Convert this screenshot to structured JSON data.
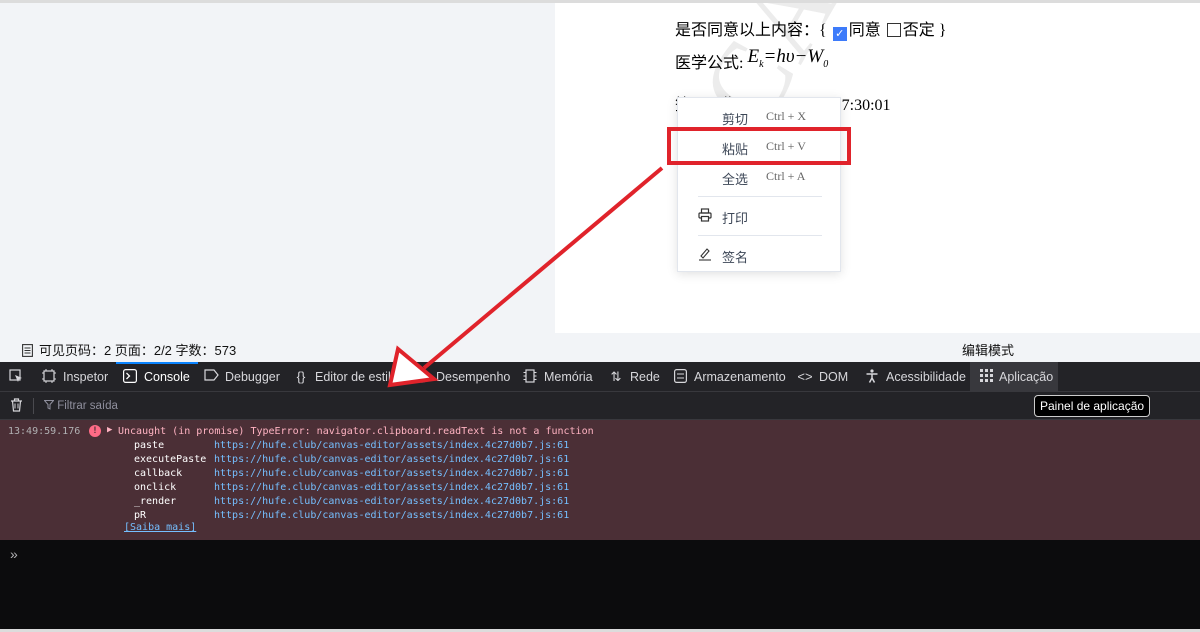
{
  "document": {
    "agree_prefix": "是否同意以上内容：{",
    "agree_yes": "同意",
    "agree_no": "否定",
    "agree_suffix": "}",
    "formula_label": "医学公式:",
    "formula_E": "E",
    "formula_k": "k",
    "formula_rest": "=hυ−W",
    "formula_0": "0",
    "date_line": "签署日期：2022-08-10 17:30:01",
    "watermark": "CANVAS-EDITOR"
  },
  "context_menu": {
    "items": [
      {
        "label": "剪切",
        "shortcut": "Ctrl + X"
      },
      {
        "label": "粘贴",
        "shortcut": "Ctrl + V"
      },
      {
        "label": "全选",
        "shortcut": "Ctrl + A"
      },
      {
        "label": "打印",
        "shortcut": ""
      },
      {
        "label": "签名",
        "shortcut": ""
      }
    ]
  },
  "footer": {
    "page_info": "可见页码：2 页面：2/2 字数：573",
    "mode": "编辑模式"
  },
  "devtools": {
    "tabs": [
      {
        "label": "Inspetor"
      },
      {
        "label": "Console"
      },
      {
        "label": "Debugger"
      },
      {
        "label": "Editor de estilos"
      },
      {
        "label": "Desempenho"
      },
      {
        "label": "Memória"
      },
      {
        "label": "Rede"
      },
      {
        "label": "Armazenamento"
      },
      {
        "label": "DOM"
      },
      {
        "label": "Acessibilidade"
      },
      {
        "label": "Aplicação"
      }
    ],
    "filter_placeholder": "Filtrar saída",
    "tooltip": "Painel de aplicação",
    "error": {
      "timestamp": "13:49:59.176",
      "message": "Uncaught (in promise) TypeError: navigator.clipboard.readText is not a function",
      "stack": [
        {
          "fn": "paste",
          "loc": "https://hufe.club/canvas-editor/assets/index.4c27d0b7.js:61"
        },
        {
          "fn": "executePaste",
          "loc": "https://hufe.club/canvas-editor/assets/index.4c27d0b7.js:61"
        },
        {
          "fn": "callback",
          "loc": "https://hufe.club/canvas-editor/assets/index.4c27d0b7.js:61"
        },
        {
          "fn": "onclick",
          "loc": "https://hufe.club/canvas-editor/assets/index.4c27d0b7.js:61"
        },
        {
          "fn": "_render",
          "loc": "https://hufe.club/canvas-editor/assets/index.4c27d0b7.js:61"
        },
        {
          "fn": "pR",
          "loc": "https://hufe.club/canvas-editor/assets/index.4c27d0b7.js:61"
        }
      ],
      "learn_more": "[Saiba mais]"
    },
    "prompt": "»"
  },
  "colors": {
    "highlight": "#e0232b",
    "error_bg": "#4b2f36",
    "link": "#75bfff",
    "checkbox": "#3d7bfa"
  }
}
